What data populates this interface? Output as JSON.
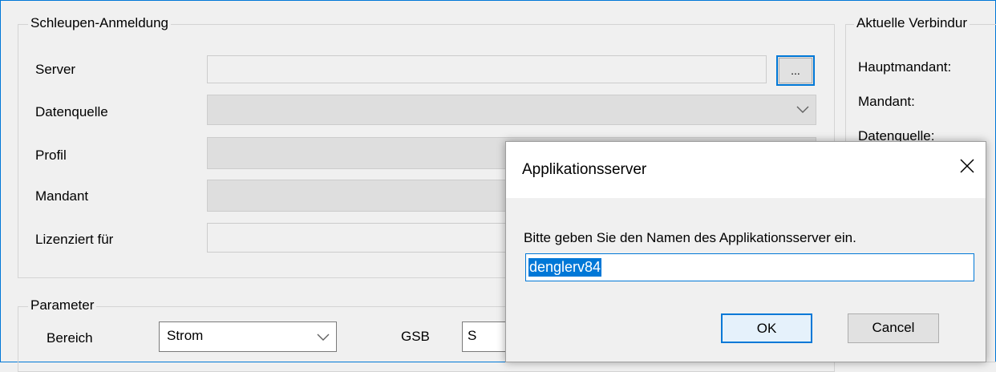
{
  "login_group": {
    "title": "Schleupen-Anmeldung",
    "server_label": "Server",
    "server_value": "",
    "browse_label": "...",
    "datenquelle_label": "Datenquelle",
    "profil_label": "Profil",
    "mandant_label": "Mandant",
    "lizenziert_label": "Lizenziert für"
  },
  "connection_group": {
    "title": "Aktuelle Verbindur",
    "hauptmandant_label": "Hauptmandant:",
    "mandant_label": "Mandant:",
    "datenquelle_label": "Datenquelle:"
  },
  "parameter_group": {
    "title": "Parameter",
    "bereich_label": "Bereich",
    "bereich_value": "Strom",
    "gsb_label": "GSB",
    "gsb_value": "S"
  },
  "dialog": {
    "title": "Applikationsserver",
    "prompt": "Bitte geben Sie den Namen des Applikationsserver ein.",
    "input_value": "denglerv84",
    "ok_label": "OK",
    "cancel_label": "Cancel"
  },
  "colors": {
    "accent": "#0078d7",
    "background": "#f0f0f0"
  }
}
